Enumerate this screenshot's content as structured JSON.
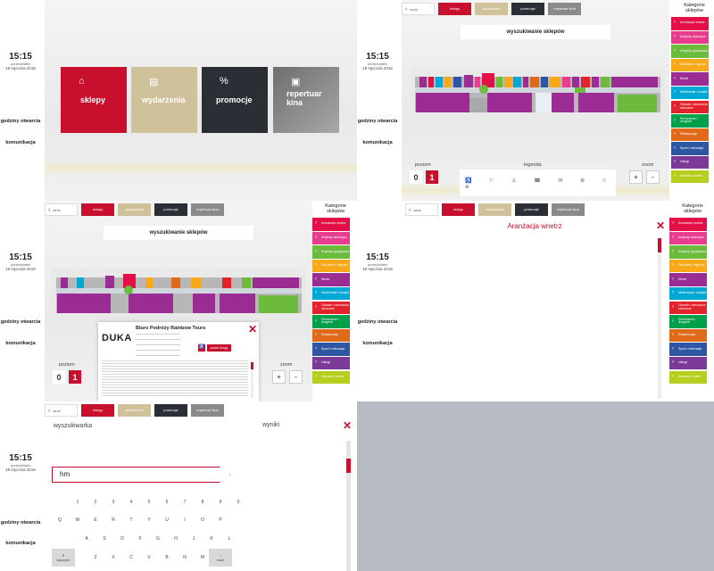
{
  "clock": {
    "time": "15:15",
    "day": "poniedziałek",
    "date": "18 stycznia 2016"
  },
  "sidebar": {
    "hours": "godziny otwarcia",
    "communication": "komunikacja"
  },
  "home": {
    "tiles": [
      {
        "label": "sklepy",
        "color": "#c8102e",
        "icon": "shopping-bag-icon"
      },
      {
        "label": "wydarzenia",
        "color": "#cfc29a",
        "icon": "calendar-icon"
      },
      {
        "label": "promocje",
        "color": "#2a2f36",
        "icon": "percent-icon"
      },
      {
        "label": "repertuar kina",
        "color": "#7c7c7c",
        "icon": "film-icon"
      }
    ]
  },
  "nav": {
    "back": "wróć",
    "tabs": [
      {
        "label": "sklepy",
        "color": "#c8102e"
      },
      {
        "label": "wydarzenia",
        "color": "#cfc29a"
      },
      {
        "label": "promocje",
        "color": "#2a2f36"
      },
      {
        "label": "repertuar kina",
        "color": "#8a8a8a"
      }
    ]
  },
  "categories": {
    "title": "Kategorie sklepów",
    "items": [
      "Aranżacja wnetrz",
      "Artykuły dziecięce",
      "Artykuły spożywcze",
      "Dla domu i ogrodu",
      "Moda",
      "Multimedia i książki",
      "Obuwie i akcesoria skórzane",
      "Perfumerie i drogerie",
      "Restauracje",
      "Sport i rekreacja",
      "Usługi",
      "Zdrowie i uroda"
    ]
  },
  "map_view": {
    "title": "wyszukiwanie sklepów",
    "level_label": "poziom",
    "levels": [
      "0",
      "1"
    ],
    "legend_label": "legenda",
    "zoom_label": "zoom",
    "zoom_in": "+",
    "zoom_out": "-"
  },
  "shop_popup": {
    "logo": "DUKA",
    "name": "Biuro Podróży Rainbow Tours",
    "button": "pokaż drogę"
  },
  "category_view": {
    "title": "Aranżacja wnetrz"
  },
  "search_view": {
    "label": "wyszukiwarka",
    "results_label": "wyniki",
    "query": "hm",
    "keys_row1": [
      "1",
      "2",
      "3",
      "4",
      "5",
      "6",
      "7",
      "8",
      "9",
      "0"
    ],
    "keys_row2": [
      "Q",
      "W",
      "E",
      "R",
      "T",
      "Y",
      "U",
      "I",
      "O",
      "P"
    ],
    "keys_row3": [
      "A",
      "S",
      "D",
      "F",
      "G",
      "H",
      "J",
      "K",
      "L"
    ],
    "keys_row4": [
      "Z",
      "X",
      "C",
      "V",
      "B",
      "N",
      "M"
    ],
    "clear_key": "wyczyść",
    "delete_key": "usuń"
  },
  "colors": {
    "brand": "#c8102e",
    "background": "#b7bcc4"
  }
}
